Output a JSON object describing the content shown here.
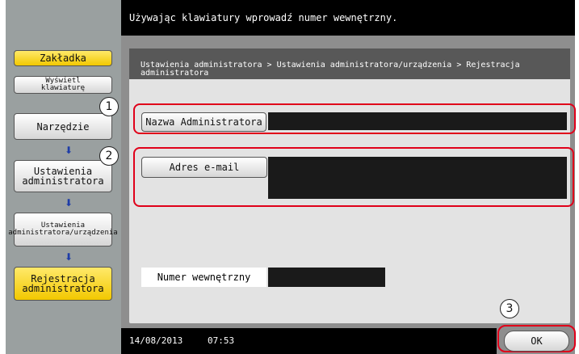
{
  "header": {
    "instruction": "Używając klawiatury wprowadź numer wewnętrzny."
  },
  "sidebar": {
    "bookmark_label": "Zakładka",
    "show_keyboard_label": "Wyświetl klawiaturę",
    "items": [
      {
        "label": "Narzędzie"
      },
      {
        "label": "Ustawienia administratora"
      },
      {
        "label": "Ustawienia administratora/urządzenia"
      },
      {
        "label": "Rejestracja administratora"
      }
    ]
  },
  "breadcrumb": {
    "text": "Ustawienia administratora > Ustawienia administratora/urządzenia > Rejestracja administratora"
  },
  "form": {
    "admin_name_label": "Nazwa Administratora",
    "admin_name_value": "",
    "email_label": "Adres e-mail",
    "email_value": "",
    "extension_label": "Numer wewnętrzny",
    "extension_value": ""
  },
  "footer": {
    "date": "14/08/2013",
    "time": "07:53",
    "ok_label": "OK"
  },
  "callouts": [
    "1",
    "2",
    "3"
  ],
  "colors": {
    "highlight_ring": "#e0001a",
    "active_button": "#f2c800",
    "arrow": "#1e3ca8"
  }
}
